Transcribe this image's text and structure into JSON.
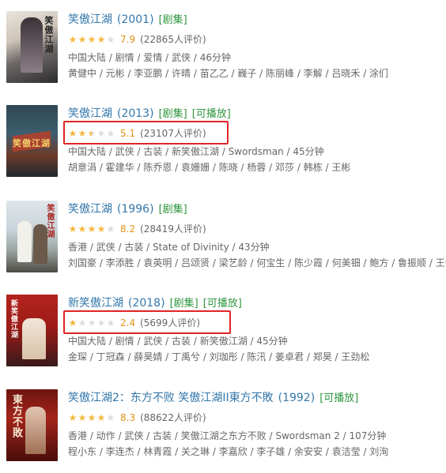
{
  "colors": {
    "link": "#3377aa",
    "tag": "#2e963d",
    "star": "#f4b73e",
    "score": "#e09015",
    "highlight": "#e02424"
  },
  "items": [
    {
      "title": "笑傲江湖",
      "year": "(2001)",
      "tags": [
        "[剧集]"
      ],
      "stars": 4,
      "score": "7.9",
      "votes": "(22865人评价)",
      "meta1": "中国大陆 / 剧情 / 爱情 / 武侠 / 46分钟",
      "meta2": "黄健中 / 元彬 / 李亚鹏 / 许晴 / 苗乙乙 / 巍子 / 陈丽峰 / 李解 / 吕晓禾 / 涂们",
      "poster_icon": "movie-poster-icon",
      "poster_text": "笑傲江湖"
    },
    {
      "title": "笑傲江湖",
      "year": "(2013)",
      "tags": [
        "[剧集]",
        "[可播放]"
      ],
      "stars": 2.5,
      "score": "5.1",
      "votes": "(23107人评价)",
      "meta1": "中国大陆 / 武侠 / 古装 / 新笑傲江湖 / Swordsman / 45分钟",
      "meta2": "胡意涓 / 霍建华 / 陈乔恩 / 袁姗姗 / 陈晓 / 杨蓉 / 邓莎 / 韩栋 / 王彬",
      "poster_icon": "movie-poster-icon",
      "poster_text": "笑傲江湖"
    },
    {
      "title": "笑傲江湖",
      "year": "(1996)",
      "tags": [
        "[剧集]"
      ],
      "stars": 4,
      "score": "8.2",
      "votes": "(28419人评价)",
      "meta1": "香港 / 武侠 / 古装 / State of Divinity / 43分钟",
      "meta2": "刘国豪 / 李添胜 / 袁英明 / 吕颂贤 / 梁艺龄 / 何宝生 / 陈少霞 / 何美钿 / 鲍方 / 鲁振顺 / 王伟",
      "poster_icon": "movie-poster-icon",
      "poster_text": "笑傲江湖"
    },
    {
      "title": "新笑傲江湖",
      "year": "(2018)",
      "tags": [
        "[剧集]",
        "[可播放]"
      ],
      "stars": 1,
      "score": "2.4",
      "votes": "(5699人评价)",
      "meta1": "中国大陆 / 剧情 / 武侠 / 古装 / 新笑傲江湖 / 45分钟",
      "meta2": "金琛 / 丁冠森 / 薛昊婧 / 丁禹兮 / 刘珈彤 / 陈汛 / 姜卓君 / 郑昊 / 王劲松",
      "poster_icon": "movie-poster-icon",
      "poster_text": "新笑傲江湖"
    },
    {
      "title": "笑傲江湖2：东方不败 笑傲江湖II東方不敗",
      "year": "(1992)",
      "tags": [
        "[可播放]"
      ],
      "stars": 4,
      "score": "8.3",
      "votes": "(88622人评价)",
      "meta1": "香港 / 动作 / 武侠 / 古装 / 笑傲江湖之东方不败 / Swordsman 2 / 107分钟",
      "meta2": "程小东 / 李连杰 / 林青霞 / 关之琳 / 李嘉欣 / 李子雄 / 余安安 / 袁洁莹 / 刘洵",
      "poster_icon": "movie-poster-icon",
      "poster_text": "東方不敗"
    }
  ]
}
